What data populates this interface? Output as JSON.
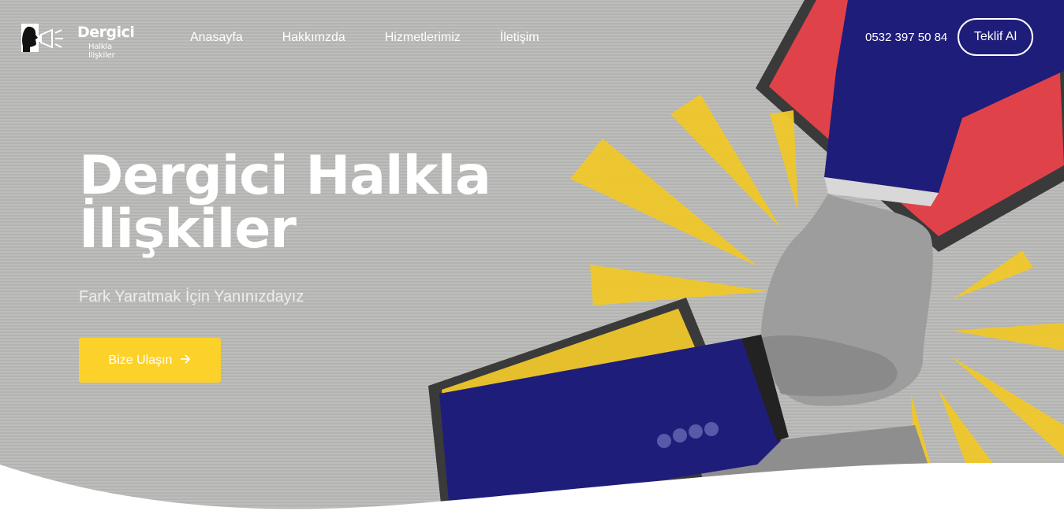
{
  "brand": {
    "title": "Dergici",
    "subtitle": "Halkla İlişkiler"
  },
  "nav": {
    "items": [
      "Anasayfa",
      "Hakkımzda",
      "Hizmetlerimiz",
      "İletişim"
    ]
  },
  "header": {
    "phone": "0532 397 50 84",
    "cta_label": "Teklif Al"
  },
  "hero": {
    "title": "Dergici Halkla İlişkiler",
    "subtitle": "Fark Yaratmak İçin Yanınızdayız",
    "button_label": "Bize Ulaşın",
    "button_icon": "arrow-right-icon"
  },
  "colors": {
    "accent_yellow": "#fcd22a",
    "background_gray": "#b9b9b7",
    "sleeve_blue": "#1f1d7a",
    "screen_red": "#e0424a"
  }
}
